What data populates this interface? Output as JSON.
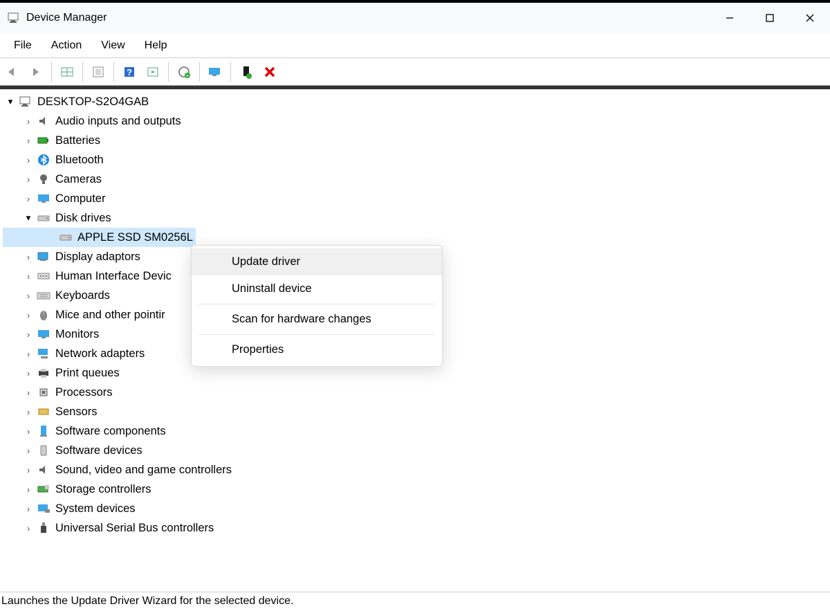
{
  "window": {
    "title": "Device Manager"
  },
  "menu": {
    "file": "File",
    "action": "Action",
    "view": "View",
    "help": "Help"
  },
  "tree": {
    "root": "DESKTOP-S2O4GAB",
    "items": [
      {
        "label": "Audio inputs and outputs"
      },
      {
        "label": "Batteries"
      },
      {
        "label": "Bluetooth"
      },
      {
        "label": "Cameras"
      },
      {
        "label": "Computer"
      },
      {
        "label": "Disk drives",
        "expanded": true,
        "children": [
          {
            "label": "APPLE SSD SM0256L",
            "selected": true
          }
        ]
      },
      {
        "label": "Display adaptors"
      },
      {
        "label": "Human Interface Devic"
      },
      {
        "label": "Keyboards"
      },
      {
        "label": "Mice and other pointir"
      },
      {
        "label": "Monitors"
      },
      {
        "label": "Network adapters"
      },
      {
        "label": "Print queues"
      },
      {
        "label": "Processors"
      },
      {
        "label": "Sensors"
      },
      {
        "label": "Software components"
      },
      {
        "label": "Software devices"
      },
      {
        "label": "Sound, video and game controllers"
      },
      {
        "label": "Storage controllers"
      },
      {
        "label": "System devices"
      },
      {
        "label": "Universal Serial Bus controllers"
      }
    ]
  },
  "context_menu": {
    "items": [
      {
        "label": "Update driver",
        "highlighted": true
      },
      {
        "label": "Uninstall device"
      },
      {
        "label": "Scan for hardware changes"
      },
      {
        "label": "Properties"
      }
    ]
  },
  "status": "Launches the Update Driver Wizard for the selected device."
}
